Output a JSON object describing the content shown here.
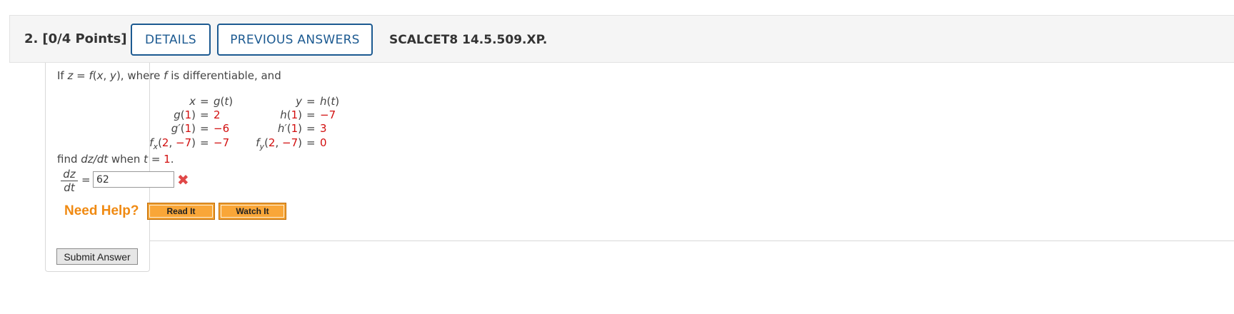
{
  "header": {
    "question_number": "2.",
    "points": "[0/4 Points]",
    "details_label": "DETAILS",
    "previous_answers_label": "PREVIOUS ANSWERS",
    "reference": "SCALCET8 14.5.509.XP."
  },
  "problem": {
    "statement": {
      "p1": "If ",
      "z": "z",
      "p2": " = ",
      "f": "f",
      "p3": "(",
      "x": "x",
      "p4": ", ",
      "y": "y",
      "p5": "), where ",
      "f2": "f",
      "p6": " is differentiable, and"
    },
    "equations": {
      "left": [
        {
          "lhs_var": "x",
          "eq": "=",
          "rhs_fn": "g",
          "rhs_open": "(",
          "rhs_arg": "t",
          "rhs_close": ")"
        },
        {
          "lhs_fn": "g",
          "lhs_open": "(",
          "lhs_arg": "1",
          "lhs_close": ")",
          "eq": "=",
          "rhs_val": "2"
        },
        {
          "lhs_fn": "g′",
          "lhs_open": "(",
          "lhs_arg": "1",
          "lhs_close": ")",
          "eq": "=",
          "rhs_val": "−6"
        },
        {
          "lhs_fn": "f",
          "lhs_sub": "x",
          "lhs_open": "(",
          "lhs_arg1": "2",
          "lhs_comma": ", ",
          "lhs_arg2": "−7",
          "lhs_close": ")",
          "eq": "=",
          "rhs_val": "−7"
        }
      ],
      "right": [
        {
          "lhs_var": "y",
          "eq": "=",
          "rhs_fn": "h",
          "rhs_open": "(",
          "rhs_arg": "t",
          "rhs_close": ")"
        },
        {
          "lhs_fn": "h",
          "lhs_open": "(",
          "lhs_arg": "1",
          "lhs_close": ")",
          "eq": "=",
          "rhs_val": "−7"
        },
        {
          "lhs_fn": "h′",
          "lhs_open": "(",
          "lhs_arg": "1",
          "lhs_close": ")",
          "eq": "=",
          "rhs_val": "3"
        },
        {
          "lhs_fn": "f",
          "lhs_sub": "y",
          "lhs_open": "(",
          "lhs_arg1": "2",
          "lhs_comma": ", ",
          "lhs_arg2": "−7",
          "lhs_close": ")",
          "eq": "=",
          "rhs_val": "0"
        }
      ]
    },
    "find": {
      "p1": "find ",
      "expr": "dz/dt",
      "p2": " when ",
      "t": "t",
      "p3": " = ",
      "val": "1",
      "p4": "."
    },
    "fraction": {
      "numerator": "dz",
      "denominator": "dt"
    },
    "equals": "=",
    "answer_value": "62",
    "incorrect_mark": "✖"
  },
  "help": {
    "label": "Need Help?",
    "read_it": "Read It",
    "watch_it": "Watch It"
  },
  "submit_label": "Submit Answer",
  "colors": {
    "accent": "#1c5a91",
    "highlight_red": "#d20f0f",
    "help_orange": "#f08a12",
    "incorrect": "#e04848"
  }
}
